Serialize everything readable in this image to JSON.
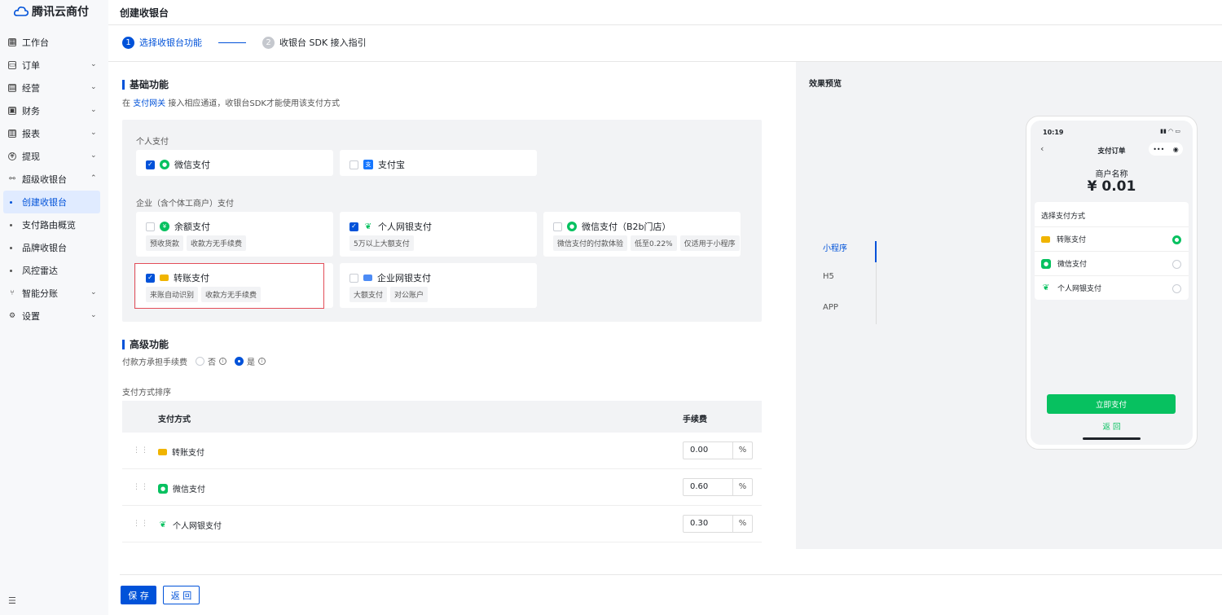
{
  "app": {
    "name": "腾讯云商付"
  },
  "sidebar": {
    "items": [
      {
        "label": "工作台"
      },
      {
        "label": "订单"
      },
      {
        "label": "经营"
      },
      {
        "label": "财务"
      },
      {
        "label": "报表"
      },
      {
        "label": "提现"
      },
      {
        "label": "超级收银台"
      }
    ],
    "sub_items": [
      {
        "label": "创建收银台",
        "active": true
      },
      {
        "label": "支付路由概览"
      },
      {
        "label": "品牌收银台"
      },
      {
        "label": "风控雷达"
      }
    ],
    "bottom_items": [
      {
        "label": "智能分账"
      },
      {
        "label": "设置"
      }
    ]
  },
  "header": {
    "title": "创建收银台"
  },
  "steps": [
    {
      "num": "1",
      "label": "选择收银台功能"
    },
    {
      "num": "2",
      "label": "收银台 SDK 接入指引"
    }
  ],
  "basic": {
    "title": "基础功能",
    "desc_prefix": "在",
    "desc_link": "支付网关",
    "desc_suffix": "接入相应通道，收银台SDK才能使用该支付方式",
    "personal_group": "个人支付",
    "enterprise_group": "企业（含个体工商户）支付",
    "personal": [
      {
        "label": "微信支付",
        "checked": true
      },
      {
        "label": "支付宝",
        "checked": false
      }
    ],
    "enterprise": [
      {
        "label": "余额支付",
        "checked": false,
        "tags": [
          "预收货款",
          "收款方无手续费"
        ]
      },
      {
        "label": "个人网银支付",
        "checked": true,
        "tags": [
          "5万以上大额支付"
        ]
      },
      {
        "label": "微信支付（B2b门店）",
        "checked": false,
        "tags": [
          "微信支付的付款体验",
          "低至0.22%",
          "仅适用于小程序"
        ]
      },
      {
        "label": "转账支付",
        "checked": true,
        "tags": [
          "来账自动识别",
          "收款方无手续费"
        ]
      },
      {
        "label": "企业网银支付",
        "checked": false,
        "tags": [
          "大额支付",
          "对公账户"
        ]
      }
    ]
  },
  "advanced": {
    "title": "高级功能",
    "fee_label": "付款方承担手续费",
    "opt_no": "否",
    "opt_yes": "是",
    "selected": "是"
  },
  "sort": {
    "label": "支付方式排序",
    "col_method": "支付方式",
    "col_fee": "手续费",
    "rows": [
      {
        "name": "转账支付",
        "fee": "0.00",
        "unit": "%"
      },
      {
        "name": "微信支付",
        "fee": "0.60",
        "unit": "%"
      },
      {
        "name": "个人网银支付",
        "fee": "0.30",
        "unit": "%"
      }
    ]
  },
  "actions": {
    "save": "保 存",
    "back": "返 回"
  },
  "preview": {
    "title": "效果预览",
    "tabs": [
      "小程序",
      "H5",
      "APP"
    ],
    "active_tab": "小程序",
    "phone": {
      "time": "10:19",
      "nav_title": "支付订单",
      "merchant": "商户名称",
      "amount": "¥ 0.01",
      "choose_title": "选择支付方式",
      "options": [
        {
          "label": "转账支付",
          "selected": true
        },
        {
          "label": "微信支付",
          "selected": false
        },
        {
          "label": "个人网银支付",
          "selected": false
        }
      ],
      "pay_btn": "立即支付",
      "return": "返 回"
    }
  },
  "colors": {
    "primary": "#0052d9",
    "wechat": "#07c160",
    "highlight": "#e34d59"
  }
}
